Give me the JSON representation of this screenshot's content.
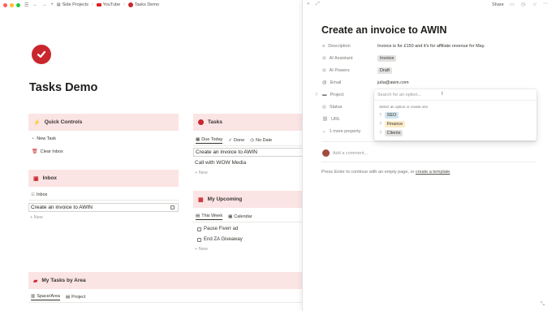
{
  "topbar": {
    "crumbs": [
      "Side Projects",
      "YouTube",
      "Tasks Demo"
    ]
  },
  "page": {
    "title": "Tasks Demo"
  },
  "quick_controls": {
    "title": "Quick Controls",
    "new_task": "New Task",
    "clear_inbox": "Clear Inbox"
  },
  "inbox": {
    "title": "Inbox",
    "view": "Inbox",
    "items": [
      "Create an invoice to AWIN"
    ],
    "new": "New"
  },
  "tasks": {
    "title": "Tasks",
    "tabs": [
      "Due Today",
      "Done",
      "No Date"
    ],
    "items": [
      "Create an invoice to AWIN",
      "Call with WOW Media"
    ],
    "new": "New"
  },
  "upcoming": {
    "title": "My Upcoming",
    "tabs": [
      "This Week",
      "Calendar"
    ],
    "items": [
      "Pause Fiverr ad",
      "End ZA Giveaway"
    ],
    "new": "New"
  },
  "tasks_by_area": {
    "title": "My Tasks by Area",
    "tabs": [
      "Space/Area",
      "Project"
    ]
  },
  "peek": {
    "share": "Share",
    "title": "Create an invoice to AWIN",
    "props": {
      "description": {
        "label": "Description",
        "value": "Invoice is for £150 and it's for affiliate revenue for May."
      },
      "ai_assistant": {
        "label": "AI Assistant",
        "value": "Invoice"
      },
      "ai_powers": {
        "label": "AI Powers",
        "value": "Draft"
      },
      "email": {
        "label": "Email",
        "value": "julia@awin.com"
      },
      "project": {
        "label": "Project"
      },
      "status": {
        "label": "Status"
      },
      "url": {
        "label": "URL"
      },
      "more": {
        "label": "1 more property"
      }
    },
    "dropdown": {
      "placeholder": "Search for an option...",
      "caption": "Select an option or create one",
      "options": [
        {
          "label": "SEO",
          "color": "#d3e5ef"
        },
        {
          "label": "Finance",
          "color": "#fdecc8"
        },
        {
          "label": "Clients",
          "color": "#e3e2e0"
        }
      ]
    },
    "comment_placeholder": "Add a comment...",
    "hint_prefix": "Press Enter to continue with an empty page, or ",
    "hint_link": "create a template"
  },
  "colors": {
    "accent": "#c9262e",
    "callout_bg": "#fbe4e4",
    "tag_invoice": "#e3e2e0",
    "tag_draft": "#e3e2e0"
  }
}
